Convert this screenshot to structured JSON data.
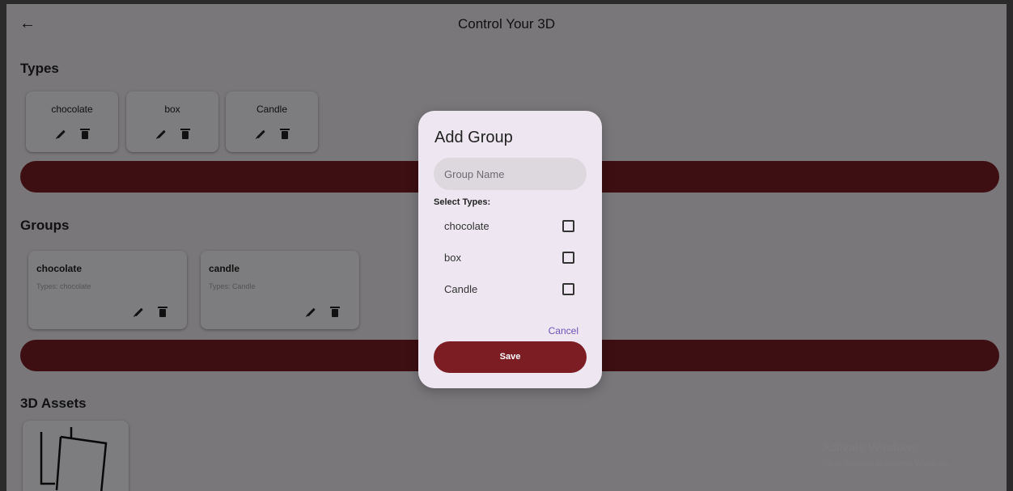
{
  "app": {
    "title": "Control Your 3D",
    "back_icon": "arrow-left-icon"
  },
  "sections": {
    "types": "Types",
    "groups": "Groups",
    "assets": "3D Assets"
  },
  "types": [
    {
      "name": "chocolate"
    },
    {
      "name": "box"
    },
    {
      "name": "Candle"
    }
  ],
  "groups": [
    {
      "name": "chocolate",
      "types": "Types: chocolate"
    },
    {
      "name": "candle",
      "types": "Types: Candle"
    }
  ],
  "dialog": {
    "title": "Add Group",
    "input_placeholder": "Group Name",
    "input_value": "",
    "select_label": "Select Types:",
    "options": [
      {
        "label": "chocolate",
        "checked": false
      },
      {
        "label": "box",
        "checked": false
      },
      {
        "label": "Candle",
        "checked": false
      }
    ],
    "cancel": "Cancel",
    "save": "Save"
  },
  "watermark": {
    "line1": "Activate Windows",
    "line2": "Go to Settings to activate Windows."
  },
  "colors": {
    "accent": "#7a1e24",
    "link": "#6a53b8",
    "dialog_bg": "#eee7f1"
  }
}
